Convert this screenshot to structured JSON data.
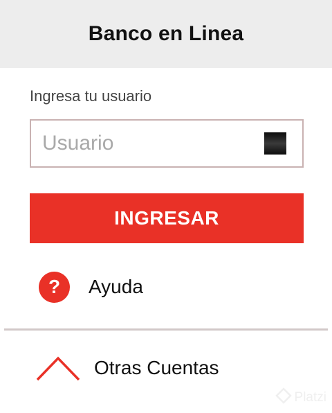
{
  "header": {
    "title": "Banco en Linea",
    "background": "#ededed"
  },
  "login_form": {
    "label": "Ingresa tu usuario",
    "username_input": {
      "placeholder": "Usuario",
      "value": ""
    },
    "submit_label": "INGRESAR",
    "accent_color": "#e93127"
  },
  "help": {
    "icon": "question-circle-icon",
    "label": "Ayuda"
  },
  "other_accounts": {
    "icon": "chevron-up-icon",
    "label": "Otras Cuentas"
  },
  "watermark": {
    "text": "Platzi"
  }
}
